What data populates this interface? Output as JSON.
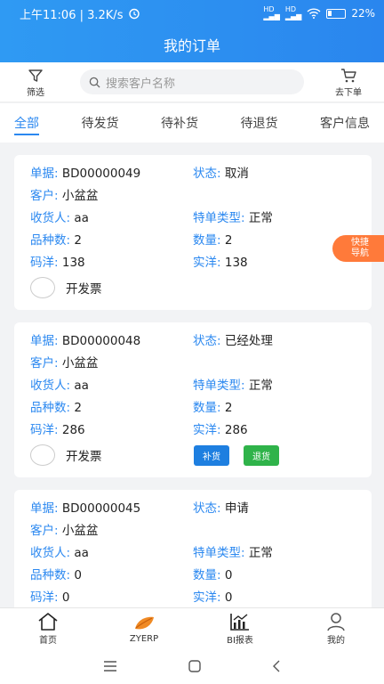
{
  "status_bar": {
    "time_speed": "上午11:06 | 3.2K/s",
    "battery": "22%"
  },
  "title": "我的订单",
  "toolbar": {
    "filter_label": "筛选",
    "search_placeholder": "搜索客户名称",
    "cart_label": "去下单"
  },
  "tabs": [
    {
      "label": "全部"
    },
    {
      "label": "待发货"
    },
    {
      "label": "待补货"
    },
    {
      "label": "待退货"
    },
    {
      "label": "客户信息"
    }
  ],
  "orders": [
    {
      "doc_key": "单据:",
      "doc": "BD00000049",
      "status_key": "状态:",
      "status": "取消",
      "customer_key": "客户:",
      "customer": "小盆盆",
      "receiver_key": "收货人:",
      "receiver": "aa",
      "type_key": "特单类型:",
      "type": "正常",
      "varieties_key": "品种数:",
      "varieties": "2",
      "qty_key": "数量:",
      "qty": "2",
      "code_key": "码洋:",
      "code": "138",
      "real_key": "实洋:",
      "real": "138",
      "invoice_label": "开发票"
    },
    {
      "doc_key": "单据:",
      "doc": "BD00000048",
      "status_key": "状态:",
      "status": "已经处理",
      "customer_key": "客户:",
      "customer": "小盆盆",
      "receiver_key": "收货人:",
      "receiver": "aa",
      "type_key": "特单类型:",
      "type": "正常",
      "varieties_key": "品种数:",
      "varieties": "2",
      "qty_key": "数量:",
      "qty": "2",
      "code_key": "码洋:",
      "code": "286",
      "real_key": "实洋:",
      "real": "286",
      "invoice_label": "开发票",
      "btn_restock": "补货",
      "btn_return": "退货"
    },
    {
      "doc_key": "单据:",
      "doc": "BD00000045",
      "status_key": "状态:",
      "status": "申请",
      "customer_key": "客户:",
      "customer": "小盆盆",
      "receiver_key": "收货人:",
      "receiver": "aa",
      "type_key": "特单类型:",
      "type": "正常",
      "varieties_key": "品种数:",
      "varieties": "0",
      "qty_key": "数量:",
      "qty": "0",
      "code_key": "码洋:",
      "code": "0",
      "real_key": "实洋:",
      "real": "0"
    }
  ],
  "quick_nav": {
    "line1": "快捷",
    "line2": "导航"
  },
  "bottom_nav": [
    {
      "label": "首页",
      "icon": "home-icon"
    },
    {
      "label": "ZYERP",
      "icon": "leaf-logo-icon"
    },
    {
      "label": "BI报表",
      "icon": "chart-icon"
    },
    {
      "label": "我的",
      "icon": "person-icon"
    }
  ],
  "colors": {
    "accent": "#2b88f0",
    "orange": "#ff7a3a",
    "green": "#2fb34a"
  }
}
